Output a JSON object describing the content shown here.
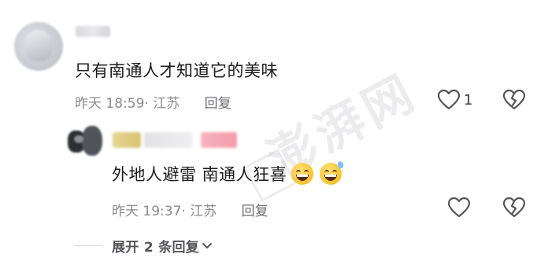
{
  "comment": {
    "text": "只有南通人才知道它的美味",
    "time": "昨天 18:59",
    "location": "· 江苏",
    "reply_label": "回复",
    "like_count": "1"
  },
  "sub_reply": {
    "text": "外地人避雷 南通人狂喜",
    "time": "昨天 19:37",
    "location": "· 江苏",
    "reply_label": "回复"
  },
  "expand": {
    "label": "展开 2 条回复"
  },
  "watermark": {
    "text": "澎湃网"
  },
  "colors": {
    "text_primary": "#1c1c1e",
    "text_meta": "#8a8a90",
    "icon": "#555559"
  }
}
